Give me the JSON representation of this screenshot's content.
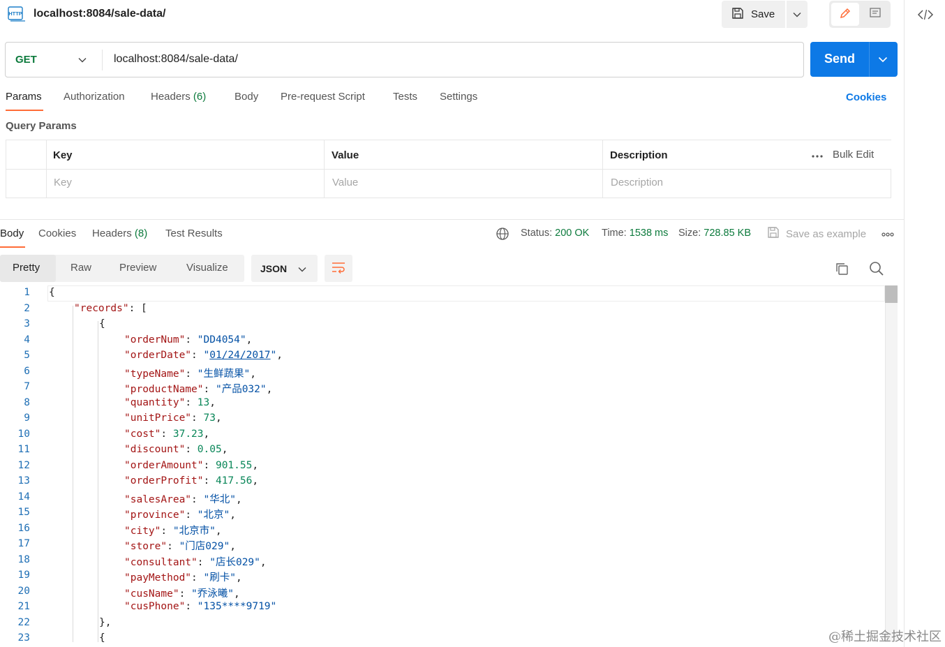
{
  "header": {
    "badge": "HTTP",
    "title": "localhost:8084/sale-data/",
    "save_label": "Save"
  },
  "request": {
    "method": "GET",
    "url": "localhost:8084/sale-data/",
    "send_label": "Send"
  },
  "request_tabs": {
    "params": "Params",
    "authorization": "Authorization",
    "headers": "Headers",
    "headers_count": "(6)",
    "body": "Body",
    "prerequest": "Pre-request Script",
    "tests": "Tests",
    "settings": "Settings",
    "cookies": "Cookies"
  },
  "query_params": {
    "title": "Query Params",
    "col_key": "Key",
    "col_value": "Value",
    "col_description": "Description",
    "bulk_edit": "Bulk Edit",
    "ph_key": "Key",
    "ph_value": "Value",
    "ph_description": "Description"
  },
  "response_tabs": {
    "body": "Body",
    "cookies": "Cookies",
    "headers": "Headers",
    "headers_count": "(8)",
    "test_results": "Test Results"
  },
  "response_meta": {
    "status_label": "Status:",
    "status_value": "200 OK",
    "time_label": "Time:",
    "time_value": "1538 ms",
    "size_label": "Size:",
    "size_value": "728.85 KB",
    "save_example": "Save as example"
  },
  "view": {
    "pretty": "Pretty",
    "raw": "Raw",
    "preview": "Preview",
    "visualize": "Visualize",
    "format": "JSON"
  },
  "code_lines": [
    {
      "n": "1",
      "indent": 0,
      "parts": [
        [
          "p",
          "{"
        ]
      ]
    },
    {
      "n": "2",
      "indent": 1,
      "parts": [
        [
          "k",
          "\"records\""
        ],
        [
          "p",
          ": ["
        ]
      ]
    },
    {
      "n": "3",
      "indent": 2,
      "parts": [
        [
          "p",
          "{"
        ]
      ]
    },
    {
      "n": "4",
      "indent": 3,
      "parts": [
        [
          "k",
          "\"orderNum\""
        ],
        [
          "p",
          ": "
        ],
        [
          "s",
          "\"DD4054\""
        ],
        [
          "p",
          ","
        ]
      ]
    },
    {
      "n": "5",
      "indent": 3,
      "parts": [
        [
          "k",
          "\"orderDate\""
        ],
        [
          "p",
          ": "
        ],
        [
          "s",
          "\""
        ],
        [
          "su",
          "01/24/2017"
        ],
        [
          "s",
          "\""
        ],
        [
          "p",
          ","
        ]
      ]
    },
    {
      "n": "6",
      "indent": 3,
      "parts": [
        [
          "k",
          "\"typeName\""
        ],
        [
          "p",
          ": "
        ],
        [
          "s",
          "\"生鲜蔬果\""
        ],
        [
          "p",
          ","
        ]
      ]
    },
    {
      "n": "7",
      "indent": 3,
      "parts": [
        [
          "k",
          "\"productName\""
        ],
        [
          "p",
          ": "
        ],
        [
          "s",
          "\"产品032\""
        ],
        [
          "p",
          ","
        ]
      ]
    },
    {
      "n": "8",
      "indent": 3,
      "parts": [
        [
          "k",
          "\"quantity\""
        ],
        [
          "p",
          ": "
        ],
        [
          "n",
          "13"
        ],
        [
          "p",
          ","
        ]
      ]
    },
    {
      "n": "9",
      "indent": 3,
      "parts": [
        [
          "k",
          "\"unitPrice\""
        ],
        [
          "p",
          ": "
        ],
        [
          "n",
          "73"
        ],
        [
          "p",
          ","
        ]
      ]
    },
    {
      "n": "10",
      "indent": 3,
      "parts": [
        [
          "k",
          "\"cost\""
        ],
        [
          "p",
          ": "
        ],
        [
          "n",
          "37.23"
        ],
        [
          "p",
          ","
        ]
      ]
    },
    {
      "n": "11",
      "indent": 3,
      "parts": [
        [
          "k",
          "\"discount\""
        ],
        [
          "p",
          ": "
        ],
        [
          "n",
          "0.05"
        ],
        [
          "p",
          ","
        ]
      ]
    },
    {
      "n": "12",
      "indent": 3,
      "parts": [
        [
          "k",
          "\"orderAmount\""
        ],
        [
          "p",
          ": "
        ],
        [
          "n",
          "901.55"
        ],
        [
          "p",
          ","
        ]
      ]
    },
    {
      "n": "13",
      "indent": 3,
      "parts": [
        [
          "k",
          "\"orderProfit\""
        ],
        [
          "p",
          ": "
        ],
        [
          "n",
          "417.56"
        ],
        [
          "p",
          ","
        ]
      ]
    },
    {
      "n": "14",
      "indent": 3,
      "parts": [
        [
          "k",
          "\"salesArea\""
        ],
        [
          "p",
          ": "
        ],
        [
          "s",
          "\"华北\""
        ],
        [
          "p",
          ","
        ]
      ]
    },
    {
      "n": "15",
      "indent": 3,
      "parts": [
        [
          "k",
          "\"province\""
        ],
        [
          "p",
          ": "
        ],
        [
          "s",
          "\"北京\""
        ],
        [
          "p",
          ","
        ]
      ]
    },
    {
      "n": "16",
      "indent": 3,
      "parts": [
        [
          "k",
          "\"city\""
        ],
        [
          "p",
          ": "
        ],
        [
          "s",
          "\"北京市\""
        ],
        [
          "p",
          ","
        ]
      ]
    },
    {
      "n": "17",
      "indent": 3,
      "parts": [
        [
          "k",
          "\"store\""
        ],
        [
          "p",
          ": "
        ],
        [
          "s",
          "\"门店029\""
        ],
        [
          "p",
          ","
        ]
      ]
    },
    {
      "n": "18",
      "indent": 3,
      "parts": [
        [
          "k",
          "\"consultant\""
        ],
        [
          "p",
          ": "
        ],
        [
          "s",
          "\"店长029\""
        ],
        [
          "p",
          ","
        ]
      ]
    },
    {
      "n": "19",
      "indent": 3,
      "parts": [
        [
          "k",
          "\"payMethod\""
        ],
        [
          "p",
          ": "
        ],
        [
          "s",
          "\"刷卡\""
        ],
        [
          "p",
          ","
        ]
      ]
    },
    {
      "n": "20",
      "indent": 3,
      "parts": [
        [
          "k",
          "\"cusName\""
        ],
        [
          "p",
          ": "
        ],
        [
          "s",
          "\"乔泳曦\""
        ],
        [
          "p",
          ","
        ]
      ]
    },
    {
      "n": "21",
      "indent": 3,
      "parts": [
        [
          "k",
          "\"cusPhone\""
        ],
        [
          "p",
          ": "
        ],
        [
          "s",
          "\"135****9719\""
        ]
      ]
    },
    {
      "n": "22",
      "indent": 2,
      "parts": [
        [
          "p",
          "},"
        ]
      ]
    },
    {
      "n": "23",
      "indent": 2,
      "parts": [
        [
          "p",
          "{"
        ]
      ]
    }
  ],
  "watermark": "@稀土掘金技术社区",
  "colors": {
    "accent_blue": "#0d79e6",
    "get_green": "#0c7a3c",
    "tab_orange": "#ff6c37",
    "json_key": "#a31515",
    "json_string": "#0451a5",
    "json_number": "#098658"
  }
}
